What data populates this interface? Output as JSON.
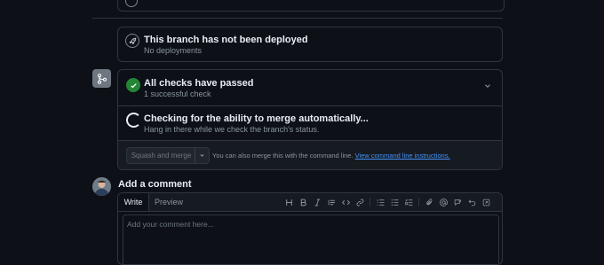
{
  "deployment": {
    "title": "This branch has not been deployed",
    "subtitle": "No deployments"
  },
  "checks": {
    "title": "All checks have passed",
    "subtitle": "1 successful check"
  },
  "mergeability": {
    "title": "Checking for the ability to merge automatically...",
    "subtitle": "Hang in there while we check the branch's status."
  },
  "merge_action": {
    "button_label": "Squash and merge",
    "hint_text": "You can also merge this with the command line.",
    "hint_link": "View command line instructions."
  },
  "comment": {
    "heading": "Add a comment",
    "tabs": [
      "Write",
      "Preview"
    ],
    "placeholder": "Add your comment here..."
  },
  "toolbar": {
    "icons": [
      "heading-icon",
      "bold-icon",
      "italic-icon",
      "quote-icon",
      "code-icon",
      "link-icon",
      "ordered-list-icon",
      "unordered-list-icon",
      "task-list-icon",
      "attach-icon",
      "mention-icon",
      "reference-icon",
      "undo-icon",
      "fullscreen-icon"
    ]
  },
  "colors": {
    "background": "#0d1117",
    "border": "#30363d",
    "success": "#238636",
    "link": "#4493f8"
  }
}
